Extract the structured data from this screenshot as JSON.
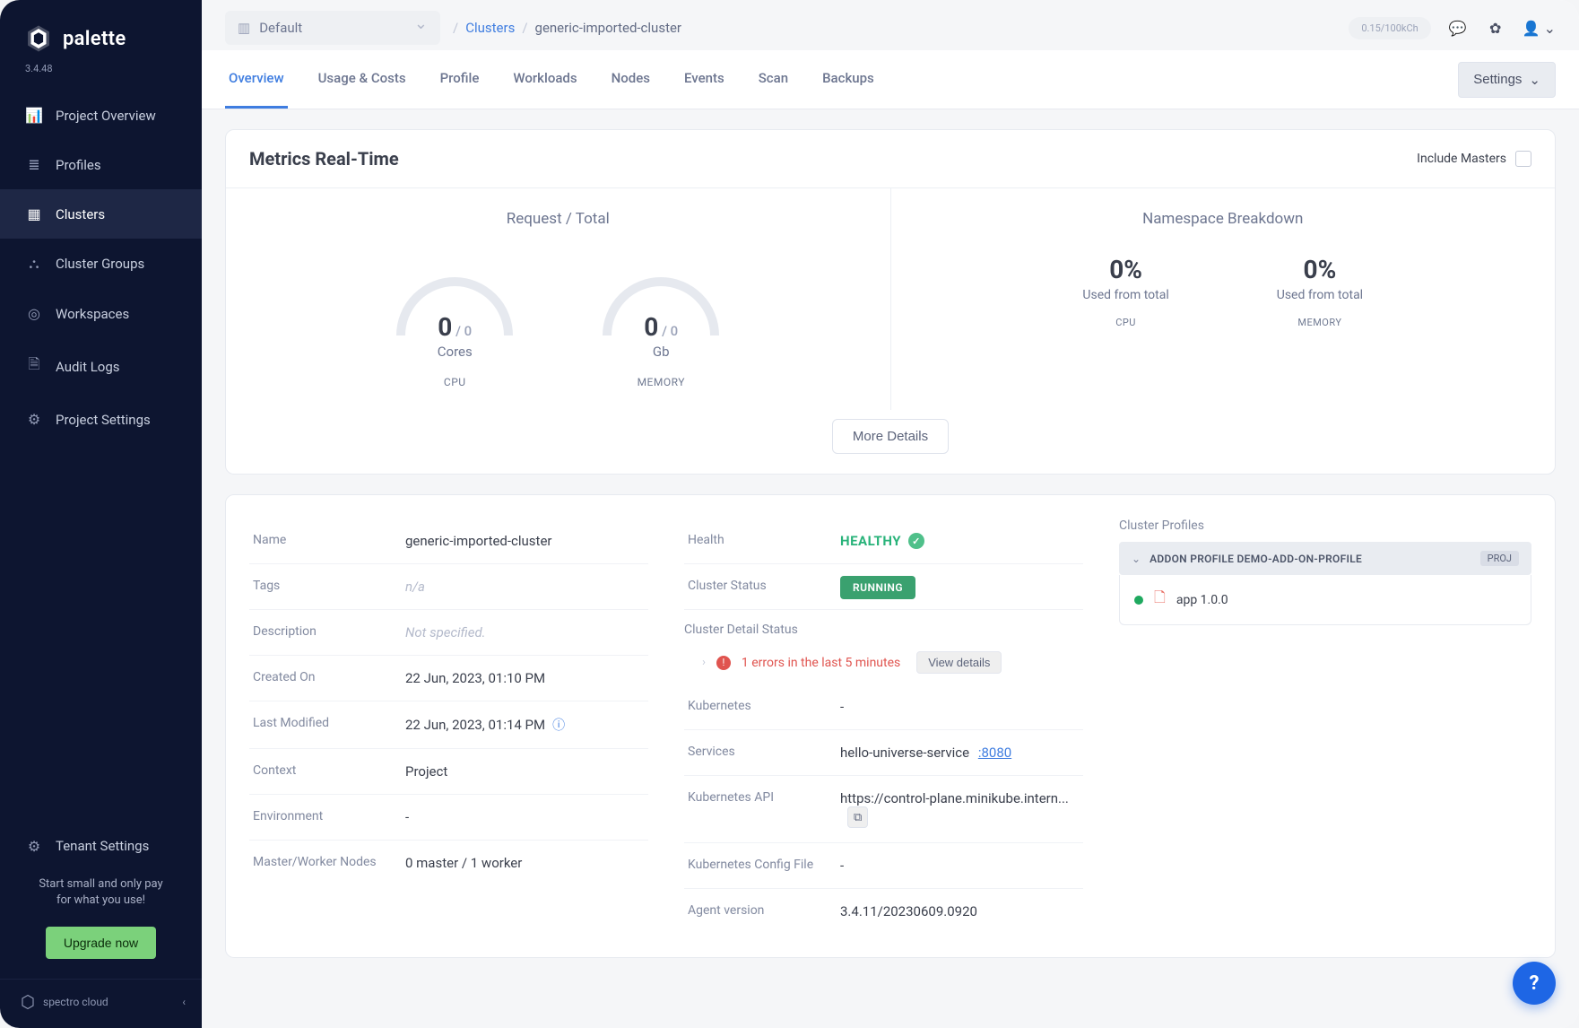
{
  "product": {
    "name": "palette",
    "version": "3.4.48"
  },
  "sidebar": {
    "items": [
      {
        "label": "Project Overview"
      },
      {
        "label": "Profiles"
      },
      {
        "label": "Clusters"
      },
      {
        "label": "Cluster Groups"
      },
      {
        "label": "Workspaces"
      },
      {
        "label": "Audit Logs"
      },
      {
        "label": "Project Settings"
      }
    ],
    "tenant_settings": "Tenant Settings",
    "promo_line1": "Start small and only pay",
    "promo_line2": "for what you use!",
    "upgrade": "Upgrade now",
    "powered_by": "spectro cloud"
  },
  "topbar": {
    "project": "Default",
    "crumb_parent": "Clusters",
    "crumb_current": "generic-imported-cluster",
    "usage": "0.15/100kCh"
  },
  "tabs": [
    "Overview",
    "Usage & Costs",
    "Profile",
    "Workloads",
    "Nodes",
    "Events",
    "Scan",
    "Backups"
  ],
  "settings_label": "Settings",
  "metrics": {
    "title": "Metrics Real-Time",
    "include_masters": "Include Masters",
    "left_title": "Request / Total",
    "right_title": "Namespace Breakdown",
    "gauge_cpu_big": "0",
    "gauge_cpu_small": " / 0",
    "gauge_cpu_unit": "Cores",
    "gauge_cpu_label": "CPU",
    "gauge_mem_big": "0",
    "gauge_mem_small": " / 0",
    "gauge_mem_unit": "Gb",
    "gauge_mem_label": "MEMORY",
    "ns_cpu_pct": "0%",
    "ns_cpu_lbl": "Used from total",
    "ns_cpu_kind": "CPU",
    "ns_mem_pct": "0%",
    "ns_mem_lbl": "Used from total",
    "ns_mem_kind": "MEMORY",
    "more": "More Details"
  },
  "details": {
    "labels": {
      "name": "Name",
      "tags": "Tags",
      "description": "Description",
      "created": "Created On",
      "modified": "Last Modified",
      "context": "Context",
      "environment": "Environment",
      "nodes": "Master/Worker Nodes",
      "health": "Health",
      "cluster_status": "Cluster Status",
      "detail_status": "Cluster Detail Status",
      "kubernetes": "Kubernetes",
      "services": "Services",
      "k8s_api": "Kubernetes API",
      "k8s_config": "Kubernetes Config File",
      "agent": "Agent version"
    },
    "values": {
      "name": "generic-imported-cluster",
      "tags": "n/a",
      "description": "Not specified.",
      "created": "22 Jun, 2023, 01:10 PM",
      "modified": "22 Jun, 2023, 01:14 PM",
      "context": "Project",
      "environment": "-",
      "nodes": "0 master / 1 worker",
      "health": "HEALTHY",
      "cluster_status": "RUNNING",
      "error_text": "1 errors in the last 5 minutes",
      "view_details": "View details",
      "kubernetes": "-",
      "service_name": "hello-universe-service",
      "service_port": ":8080",
      "k8s_api": "https://control-plane.minikube.intern...",
      "k8s_config": "-",
      "agent": "3.4.11/20230609.0920"
    }
  },
  "profiles": {
    "title": "Cluster Profiles",
    "header": "ADDON PROFILE DEMO-ADD-ON-PROFILE",
    "tag": "PROJ",
    "item": "app 1.0.0"
  },
  "help": "?"
}
